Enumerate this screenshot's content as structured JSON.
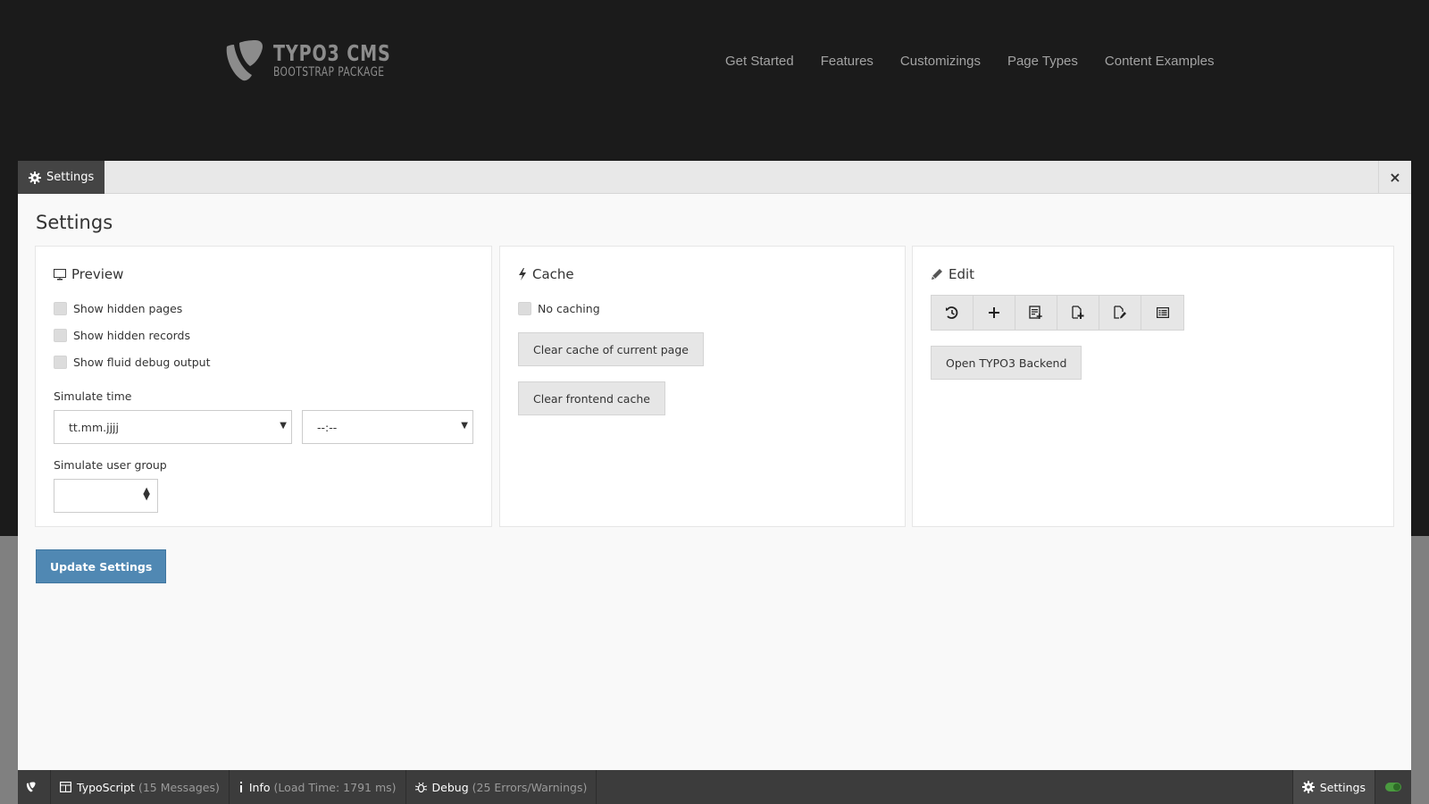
{
  "site": {
    "logo_title": "TYPO3 CMS",
    "logo_subtitle": "BOOTSTRAP PACKAGE",
    "nav": [
      "Get Started",
      "Features",
      "Customizings",
      "Page Types",
      "Content Examples"
    ]
  },
  "panel": {
    "tab_label": "Settings",
    "close_label": "×",
    "title": "Settings",
    "preview": {
      "heading": "Preview",
      "checkboxes": [
        {
          "label": "Show hidden pages",
          "checked": false
        },
        {
          "label": "Show hidden records",
          "checked": false
        },
        {
          "label": "Show fluid debug output",
          "checked": false
        }
      ],
      "simulate_time_label": "Simulate time",
      "date_value": "tt.mm.jjjj",
      "time_value": "--:--",
      "simulate_group_label": "Simulate user group",
      "group_value": ""
    },
    "cache": {
      "heading": "Cache",
      "no_caching_label": "No caching",
      "no_caching_checked": false,
      "clear_current_label": "Clear cache of current page",
      "clear_frontend_label": "Clear frontend cache"
    },
    "edit": {
      "heading": "Edit",
      "toolbar_icons": [
        "history-icon",
        "add-icon",
        "new-content-icon",
        "new-page-icon",
        "edit-page-icon",
        "page-list-icon"
      ],
      "open_backend_label": "Open TYPO3 Backend"
    },
    "update_label": "Update Settings"
  },
  "statusbar": {
    "typoscript_label": "TypoScript",
    "typoscript_detail": "(15 Messages)",
    "info_label": "Info",
    "info_detail": "(Load Time: 1791 ms)",
    "debug_label": "Debug",
    "debug_detail": "(25 Errors/Warnings)",
    "settings_label": "Settings",
    "toggle_on": true
  },
  "colors": {
    "header_bg": "#1b1b1b",
    "primary": "#5088b3",
    "statusbar_bg": "#3c3c3c",
    "toggle_green": "#4a9a3f"
  }
}
